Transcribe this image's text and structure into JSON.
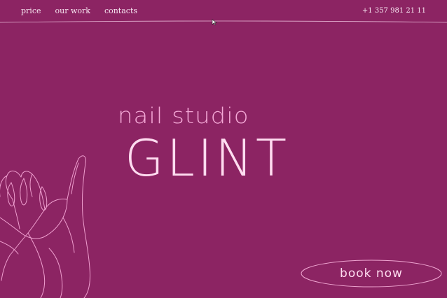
{
  "nav": {
    "items": [
      {
        "label": "price"
      },
      {
        "label": "our work"
      },
      {
        "label": "contacts"
      }
    ]
  },
  "contact": {
    "phone": "+1 357 981 21 11"
  },
  "hero": {
    "subtitle": "nail studio",
    "brand": "GLINT"
  },
  "cta": {
    "label": "book now"
  },
  "colors": {
    "background": "#8c2463",
    "text_light": "#f7e6f1",
    "accent_pink": "#f4a8d6",
    "line_pink": "#f0a6d2"
  },
  "icons": {
    "cursor": "mouse-pointer-icon",
    "illustration": "hands-line-illustration"
  }
}
